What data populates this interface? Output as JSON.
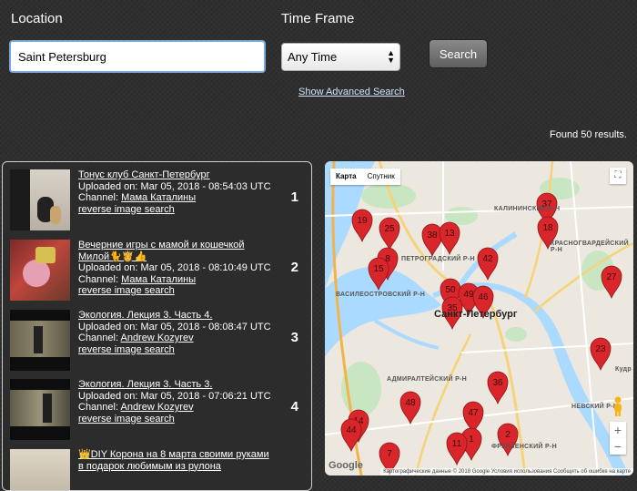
{
  "search": {
    "location_label": "Location",
    "location_value": "Saint Petersburg",
    "timeframe_label": "Time Frame",
    "timeframe_value": "Any Time",
    "search_button": "Search",
    "advanced_link": "Show Advanced Search",
    "results_count": "Found 50 results."
  },
  "results": [
    {
      "title": "Тонус клуб Санкт-Петербург",
      "uploaded": "Uploaded on: Mar 05, 2018 - 08:54:03 UTC",
      "channel_prefix": "Channel: ",
      "channel": "Мама Каталины",
      "reverse": "reverse image search",
      "number": "1"
    },
    {
      "title": "Вечерние игры с мамой и кошечкой Милой🐈👸👍",
      "uploaded": "Uploaded on: Mar 05, 2018 - 08:10:49 UTC",
      "channel_prefix": "Channel: ",
      "channel": "Мама Каталины",
      "reverse": "reverse image search",
      "number": "2"
    },
    {
      "title": "Экология. Лекция 3. Часть 4.",
      "uploaded": "Uploaded on: Mar 05, 2018 - 08:08:47 UTC",
      "channel_prefix": "Channel: ",
      "channel": "Andrew Kozyrev",
      "reverse": "reverse image search",
      "number": "3"
    },
    {
      "title": "Экология. Лекция 3. Часть 3.",
      "uploaded": "Uploaded on: Mar 05, 2018 - 07:06:21 UTC",
      "channel_prefix": "Channel: ",
      "channel": "Andrew Kozyrev",
      "reverse": "reverse image search",
      "number": "4"
    },
    {
      "title": "👑DIY Корона на 8 марта своими руками в подарок любимым из рулона",
      "uploaded": "",
      "channel_prefix": "",
      "channel": "",
      "reverse": "",
      "number": ""
    }
  ],
  "map": {
    "map_type_buttons": [
      "Карта",
      "Спутник"
    ],
    "zoom_in": "+",
    "zoom_out": "−",
    "fullscreen_icon": "fullscreen-icon",
    "google_logo": "Google",
    "attribution": "Картографические данные © 2018 Google   Условия использования   Сообщить об ошибке на карте",
    "city_label": "Санкт-Петербург",
    "districts": [
      "КАЛИНИНСКИЙ Р-Н",
      "ПЕТРОГРАДСКИЙ Р-Н",
      "КРАСНОГВАРДЕЙСКИЙ Р-Н",
      "ВАСИЛЕОСТРОВСКИЙ Р-Н",
      "АДМИРАЛТЕЙСКИЙ Р-Н",
      "НЕВСКИЙ Р-Н",
      "ФРУНЗЕНСКИЙ Р-Н",
      "Кудр"
    ],
    "markers": [
      "19",
      "25",
      "38",
      "13",
      "37",
      "18",
      "8",
      "15",
      "42",
      "27",
      "50",
      "49",
      "46",
      "35",
      "23",
      "36",
      "48",
      "14",
      "47",
      "2",
      "44",
      "1",
      "11",
      "7"
    ],
    "pin_color": "#d9262b"
  }
}
